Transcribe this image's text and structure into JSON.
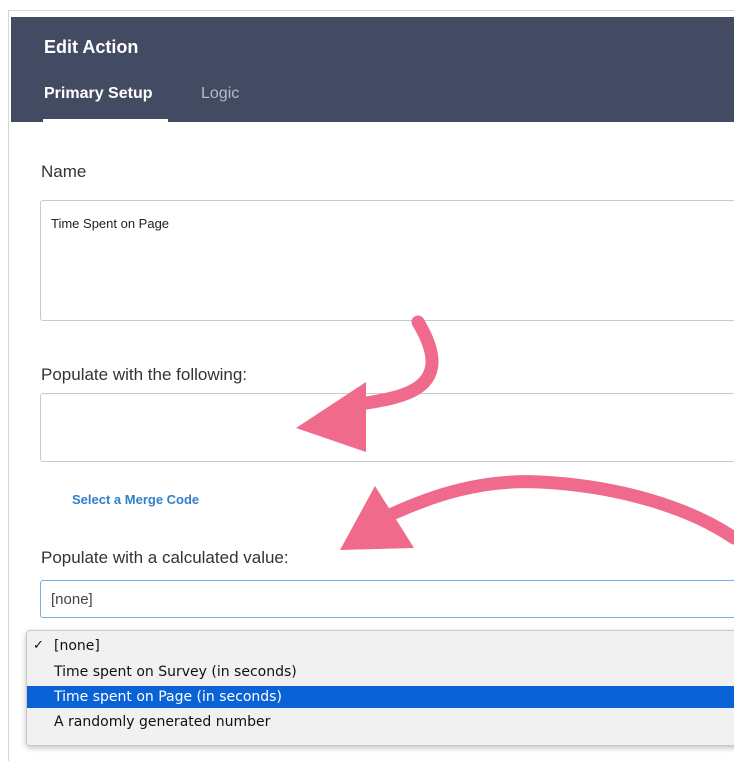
{
  "header": {
    "title": "Edit Action",
    "tabs": [
      {
        "label": "Primary Setup",
        "active": true
      },
      {
        "label": "Logic",
        "active": false
      }
    ]
  },
  "form": {
    "name_label": "Name",
    "name_value": "Time Spent on Page",
    "populate_label": "Populate with the following:",
    "populate_value": "",
    "merge_link": "Select a Merge Code",
    "calculated_label": "Populate with a calculated value:",
    "calculated_value": "[none]"
  },
  "dropdown": {
    "check_glyph": "✓",
    "options": [
      {
        "label": "[none]",
        "checked": true,
        "highlighted": false
      },
      {
        "label": "Time spent on Survey (in seconds)",
        "checked": false,
        "highlighted": false
      },
      {
        "label": "Time spent on Page (in seconds)",
        "checked": false,
        "highlighted": true
      },
      {
        "label": "A randomly generated number",
        "checked": false,
        "highlighted": false
      }
    ]
  },
  "colors": {
    "header_bg": "#434b63",
    "link": "#2f80c9",
    "highlight": "#0a63d6",
    "annotation_arrow": "#f06a8c"
  }
}
